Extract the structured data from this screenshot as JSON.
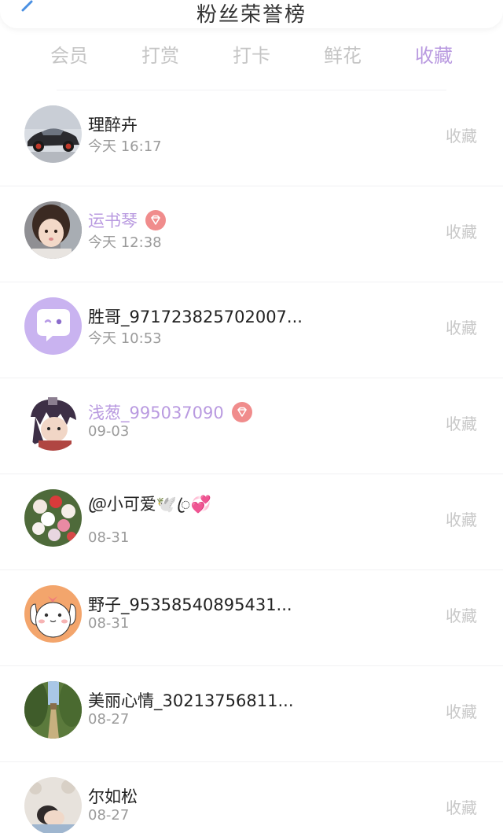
{
  "header": {
    "title": "粉丝荣誉榜",
    "back_icon": "chevron-left-icon",
    "accent": "#b99ae0"
  },
  "tabs": [
    {
      "label": "会员",
      "active": false
    },
    {
      "label": "打赏",
      "active": false
    },
    {
      "label": "打卡",
      "active": false
    },
    {
      "label": "鲜花",
      "active": false
    },
    {
      "label": "收藏",
      "active": true
    }
  ],
  "list": [
    {
      "name": "理醉卉",
      "time": "今天 16:17",
      "action": "收藏",
      "vip": false,
      "avatar": "car-photo"
    },
    {
      "name": "运书琴",
      "time": "今天 12:38",
      "action": "收藏",
      "vip": true,
      "avatar": "child-photo"
    },
    {
      "name": "胜哥_971723825702007...",
      "time": "今天 10:53",
      "action": "收藏",
      "vip": false,
      "avatar": "default-chat-avatar"
    },
    {
      "name": "浅葱_995037090",
      "time": "09-03",
      "action": "收藏",
      "vip": true,
      "avatar": "anime-photo"
    },
    {
      "name": "@ꦿ小可爱🕊️ꦿ💞",
      "time": "08-31",
      "action": "收藏",
      "vip": false,
      "avatar": "flowers-photo"
    },
    {
      "name": "野子_95358540895431...",
      "time": "08-31",
      "action": "收藏",
      "vip": false,
      "avatar": "cartoon-dog"
    },
    {
      "name": "美丽心情_30213756811...",
      "time": "08-27",
      "action": "收藏",
      "vip": false,
      "avatar": "garden-photo"
    },
    {
      "name": "尔如松",
      "time": "08-27",
      "action": "收藏",
      "vip": false,
      "avatar": "sleeping-person-photo"
    }
  ]
}
